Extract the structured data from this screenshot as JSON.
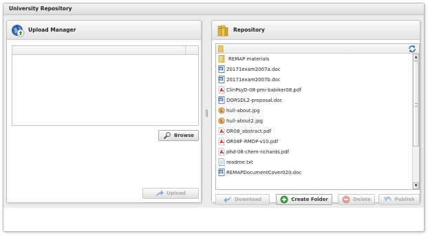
{
  "app": {
    "title": "University Repository"
  },
  "upload_manager": {
    "title": "Upload Manager",
    "icon": "globe-upload-icon",
    "browse_label": "Browse",
    "upload_label": "Upload"
  },
  "repository": {
    "title": "Repository",
    "icon": "repository-books-icon",
    "files": [
      {
        "name": "REMAP materials",
        "type": "folder"
      },
      {
        "name": "20171exam2007a.doc",
        "type": "doc"
      },
      {
        "name": "20171exam2007b.doc",
        "type": "doc"
      },
      {
        "name": "ClinPsyD-08-pmi-babiker08.pdf",
        "type": "pdf"
      },
      {
        "name": "DORSDL2-proposal.doc",
        "type": "doc"
      },
      {
        "name": "hull-about.jpg",
        "type": "jpg"
      },
      {
        "name": "hull-about2.jpg",
        "type": "jpg"
      },
      {
        "name": "OR08_abstract.pdf",
        "type": "pdf"
      },
      {
        "name": "OR08F-RMDP-v10.pdf",
        "type": "pdf"
      },
      {
        "name": "phd-08-chem-richards.pdf",
        "type": "pdf"
      },
      {
        "name": "readme.txt",
        "type": "txt"
      },
      {
        "name": "REMAPDocumentCover020.doc",
        "type": "doc"
      }
    ],
    "buttons": {
      "download": "Download",
      "create_folder": "Create Folder",
      "delete": "Delete",
      "publish": "Publish"
    }
  },
  "colors": {
    "folder": "#e8c46a",
    "doc_blue": "#3a5fb0",
    "pdf_red": "#c8292a",
    "accent_blue": "#2d6fc0",
    "create_green": "#3aa03a",
    "delete_red": "#d9534f"
  }
}
